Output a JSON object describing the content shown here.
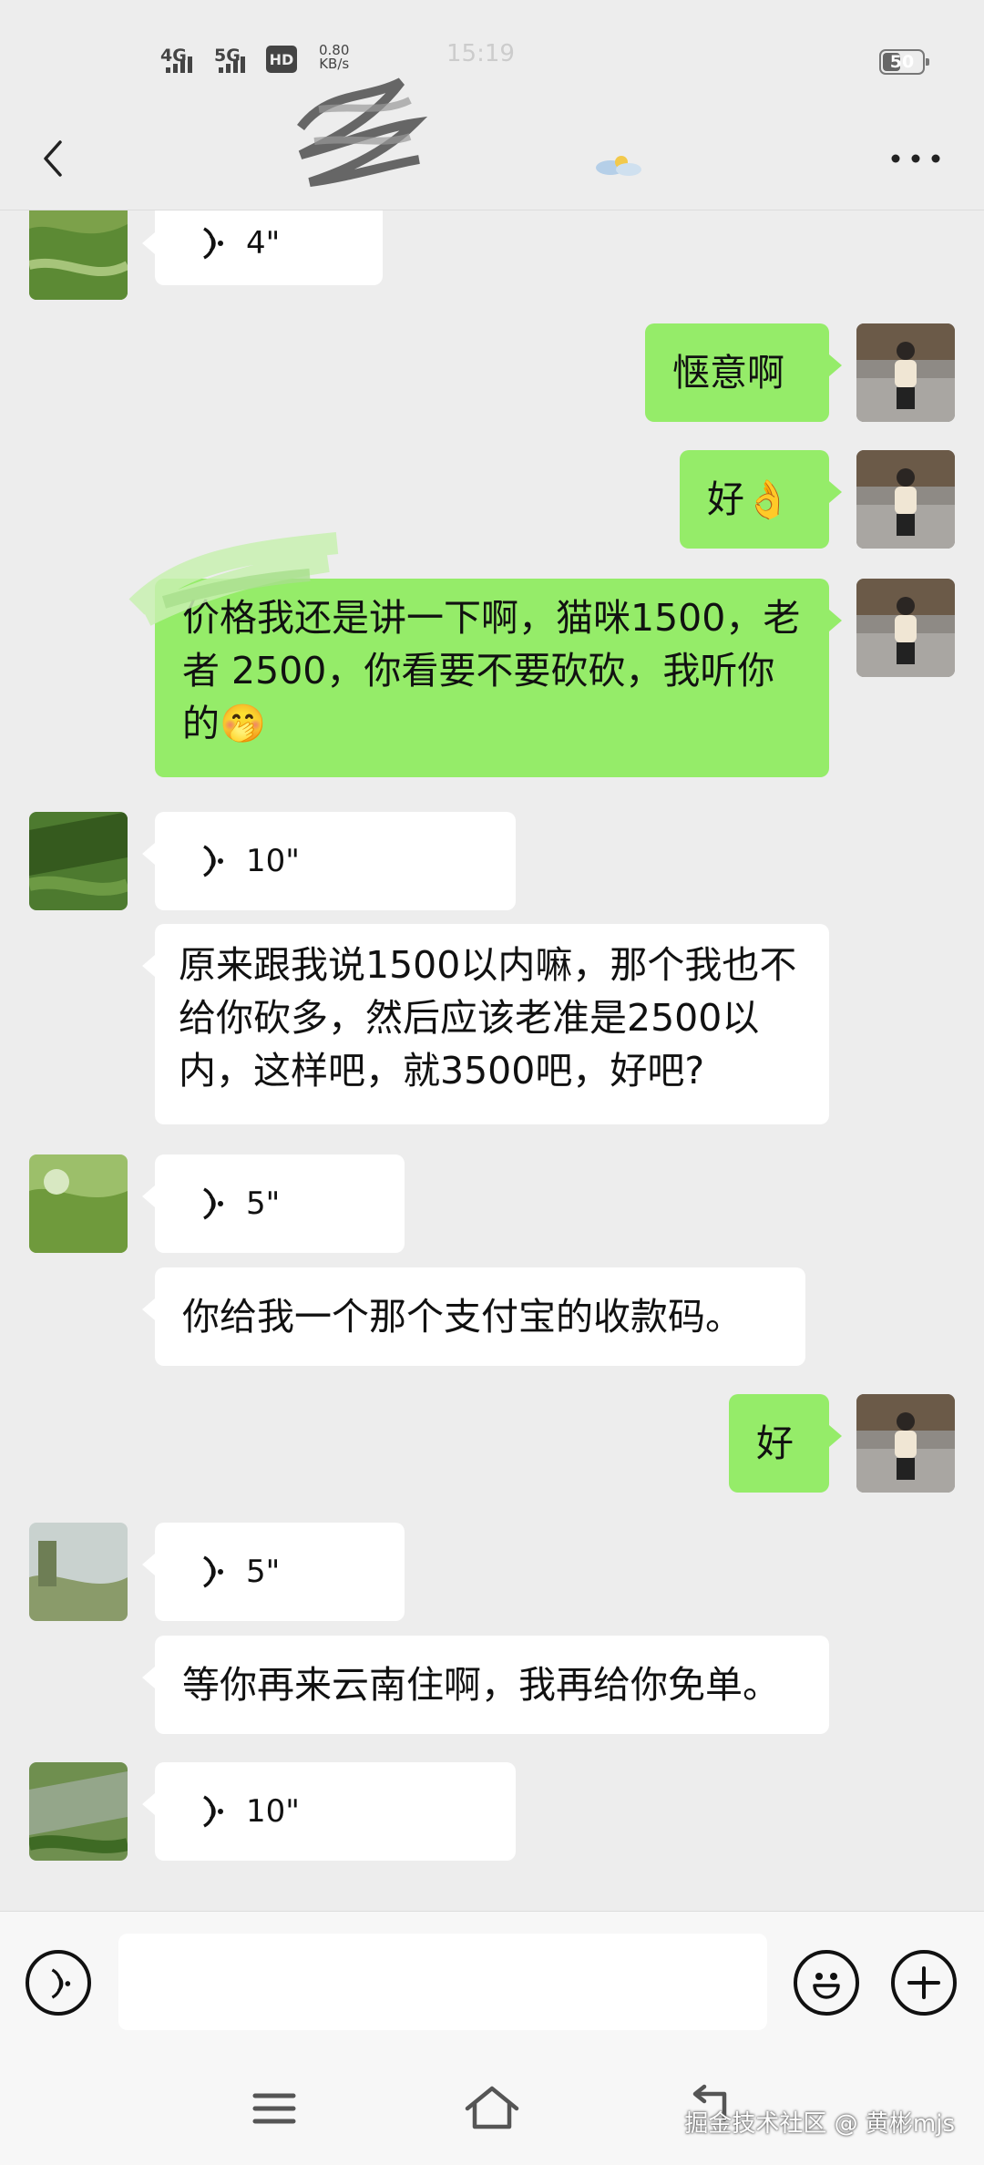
{
  "status_bar": {
    "network_1": "4G",
    "network_2": "5G",
    "hd_badge": "HD",
    "net_speed_value": "0.80",
    "net_speed_unit": "KB/s",
    "time": "15:19",
    "battery": "50"
  },
  "header": {
    "title": ""
  },
  "messages": [
    {
      "kind": "voice",
      "side": "in",
      "duration": "4\""
    },
    {
      "kind": "text",
      "side": "out",
      "text": "惬意啊"
    },
    {
      "kind": "text",
      "side": "out",
      "text": "好👌"
    },
    {
      "kind": "text",
      "side": "out",
      "text": "价格我还是讲一下啊，猫咪1500，老者 2500，你看要不要砍砍，我听你的🤭"
    },
    {
      "kind": "voice",
      "side": "in",
      "duration": "10\""
    },
    {
      "kind": "text",
      "side": "in",
      "text": "原来跟我说1500以内嘛，那个我也不给你砍多，然后应该老准是2500以内，这样吧，就3500吧，好吧?"
    },
    {
      "kind": "voice",
      "side": "in",
      "duration": "5\""
    },
    {
      "kind": "text",
      "side": "in",
      "text": "你给我一个那个支付宝的收款码。"
    },
    {
      "kind": "text",
      "side": "out",
      "text": "好"
    },
    {
      "kind": "voice",
      "side": "in",
      "duration": "5\""
    },
    {
      "kind": "text",
      "side": "in",
      "text": "等你再来云南住啊，我再给你免单。"
    },
    {
      "kind": "voice",
      "side": "in",
      "duration": "10\""
    }
  ],
  "input_bar": {
    "placeholder": ""
  },
  "watermark": "掘金技术社区 @ 黄彬mjs",
  "colors": {
    "background": "#ededed",
    "outgoing_bubble": "#95ec69",
    "incoming_bubble": "#ffffff"
  }
}
